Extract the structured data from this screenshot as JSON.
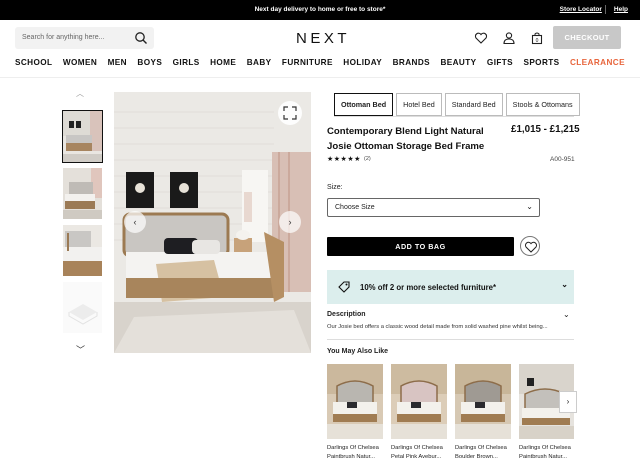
{
  "topbar": {
    "promo": "Next day delivery to home or free to store*",
    "store_locator": "Store Locator",
    "help": "Help"
  },
  "header": {
    "search_placeholder": "Search for anything here...",
    "logo": "NEXT",
    "checkout": "CHECKOUT"
  },
  "nav": [
    "SCHOOL",
    "WOMEN",
    "MEN",
    "BOYS",
    "GIRLS",
    "HOME",
    "BABY",
    "FURNITURE",
    "HOLIDAY",
    "BRANDS",
    "BEAUTY",
    "GIFTS",
    "SPORTS"
  ],
  "nav_clearance": "CLEARANCE",
  "tabs": [
    "Ottoman Bed",
    "Hotel Bed",
    "Standard Bed",
    "Stools & Ottomans"
  ],
  "product": {
    "title": "Contemporary Blend Light Natural Josie Ottoman Storage Bed Frame",
    "price": "£1,015 - £1,215",
    "stars": "★★★★★",
    "review_count": "(2)",
    "sku": "A00-951",
    "size_label": "Size:",
    "size_value": "Choose Size",
    "add_to_bag": "ADD TO BAG"
  },
  "promo_offer": "10% off 2 or more selected furniture*",
  "description": {
    "heading": "Description",
    "text": "Our Josie bed offers a classic wood detail made from solid washed pine whilst being..."
  },
  "also_like": {
    "heading": "You May Also Like",
    "items": [
      {
        "l1": "Darlings Of Chelsea",
        "l2": "Paintbrush Natur..."
      },
      {
        "l1": "Darlings Of Chelsea",
        "l2": "Petal Pink Avebur..."
      },
      {
        "l1": "Darlings Of Chelsea",
        "l2": "Boulder Brown..."
      },
      {
        "l1": "Darlings Of Chelsea",
        "l2": "Paintbrush Natur..."
      }
    ]
  },
  "colors": {
    "accent_clearance": "#e8663d",
    "promo_bg": "#dceeed",
    "primary": "#000000"
  }
}
